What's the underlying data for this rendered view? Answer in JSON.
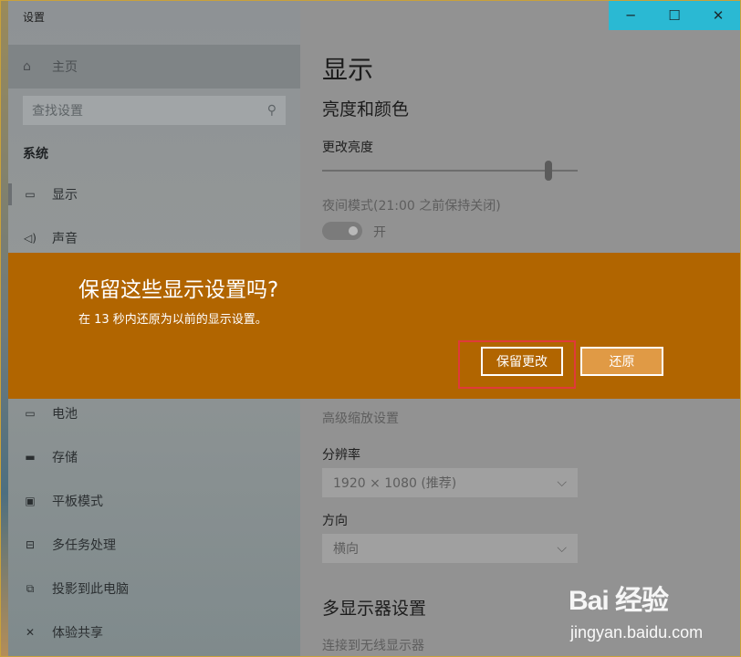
{
  "window": {
    "title": "设置",
    "minimize_glyph": "─",
    "maximize_glyph": "☐",
    "close_glyph": "✕"
  },
  "sidebar": {
    "home_label": "主页",
    "search_placeholder": "查找设置",
    "section_label": "系统",
    "items": [
      {
        "label": "显示",
        "icon": "monitor-icon"
      },
      {
        "label": "声音",
        "icon": "speaker-icon"
      },
      {
        "label": "电池",
        "icon": "battery-icon"
      },
      {
        "label": "存储",
        "icon": "storage-icon"
      },
      {
        "label": "平板模式",
        "icon": "tablet-mode-icon"
      },
      {
        "label": "多任务处理",
        "icon": "multitasking-icon"
      },
      {
        "label": "投影到此电脑",
        "icon": "project-icon"
      },
      {
        "label": "体验共享",
        "icon": "share-icon"
      }
    ]
  },
  "main": {
    "page_title": "显示",
    "brightness_section": "亮度和颜色",
    "brightness_label": "更改亮度",
    "night_light_label": "夜间模式(21:00 之前保持关闭)",
    "night_light_toggle_state": "开",
    "advanced_scaling_link": "高级缩放设置",
    "resolution_label": "分辨率",
    "resolution_value": "1920 × 1080 (推荐)",
    "orientation_label": "方向",
    "orientation_value": "横向",
    "multi_display_section": "多显示器设置",
    "wireless_display_link": "连接到无线显示器"
  },
  "dialog": {
    "title": "保留这些显示设置吗?",
    "message": "在 13 秒内还原为以前的显示设置。",
    "keep_button": "保留更改",
    "revert_button": "还原"
  },
  "watermark": {
    "logo": "Bai 经验",
    "url": "jingyan.baidu.com"
  },
  "colors": {
    "dialog_background": "#b16500",
    "caption_accent": "#2ab9d3",
    "highlight_border": "#e03a3a"
  }
}
